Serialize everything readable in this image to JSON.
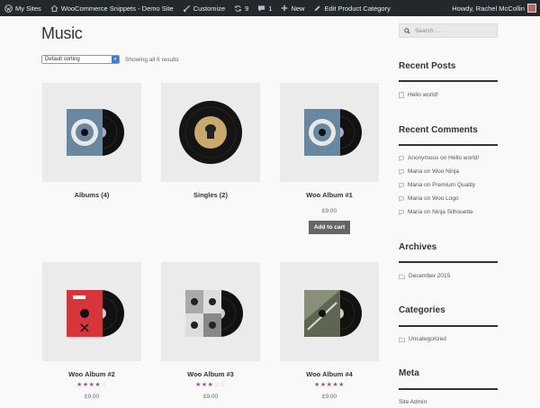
{
  "adminbar": {
    "my_sites": "My Sites",
    "site_name": "WooCommerce Snippets - Demo Site",
    "customize": "Customize",
    "updates_count": "9",
    "comments_count": "1",
    "new": "New",
    "edit_category": "Edit Product Category",
    "howdy": "Howdy, Rachel McCollin"
  },
  "page": {
    "title": "Music",
    "sorting": "Default sorting",
    "result_count": "Showing all 6 results"
  },
  "products": [
    {
      "name": "Albums",
      "count": "(4)",
      "image": "vinyl-sleeve-blue-icon"
    },
    {
      "name": "Singles",
      "count": "(2)",
      "image": "vinyl-record-gold-icon"
    },
    {
      "name": "Woo Album #1",
      "price": "£9.00",
      "button": "Add to cart",
      "image": "vinyl-sleeve-blue-icon"
    },
    {
      "name": "Woo Album #2",
      "price": "£9.00",
      "rating": 4,
      "image": "vinyl-sleeve-red-icon"
    },
    {
      "name": "Woo Album #3",
      "price": "£9.00",
      "rating": 3,
      "image": "vinyl-sleeve-grey-icon"
    },
    {
      "name": "Woo Album #4",
      "price": "£9.00",
      "rating": 5,
      "image": "vinyl-sleeve-green-icon"
    }
  ],
  "sidebar": {
    "search_placeholder": "Search …",
    "recent_posts": {
      "title": "Recent Posts",
      "items": [
        "Hello world!"
      ]
    },
    "recent_comments": {
      "title": "Recent Comments",
      "items": [
        "Anonymous on Hello world!",
        "Maria on Woo Ninja",
        "Maria on Premium Quality",
        "Maria on Woo Logo",
        "Maria on Ninja Silhouette"
      ]
    },
    "archives": {
      "title": "Archives",
      "items": [
        "December 2015"
      ]
    },
    "categories": {
      "title": "Categories",
      "items": [
        "Uncategorized"
      ]
    },
    "meta": {
      "title": "Meta",
      "items": [
        "Site Admin"
      ]
    }
  },
  "colors": {
    "admin_bar": "#23282d",
    "star": "#96588a",
    "button": "#666666"
  }
}
